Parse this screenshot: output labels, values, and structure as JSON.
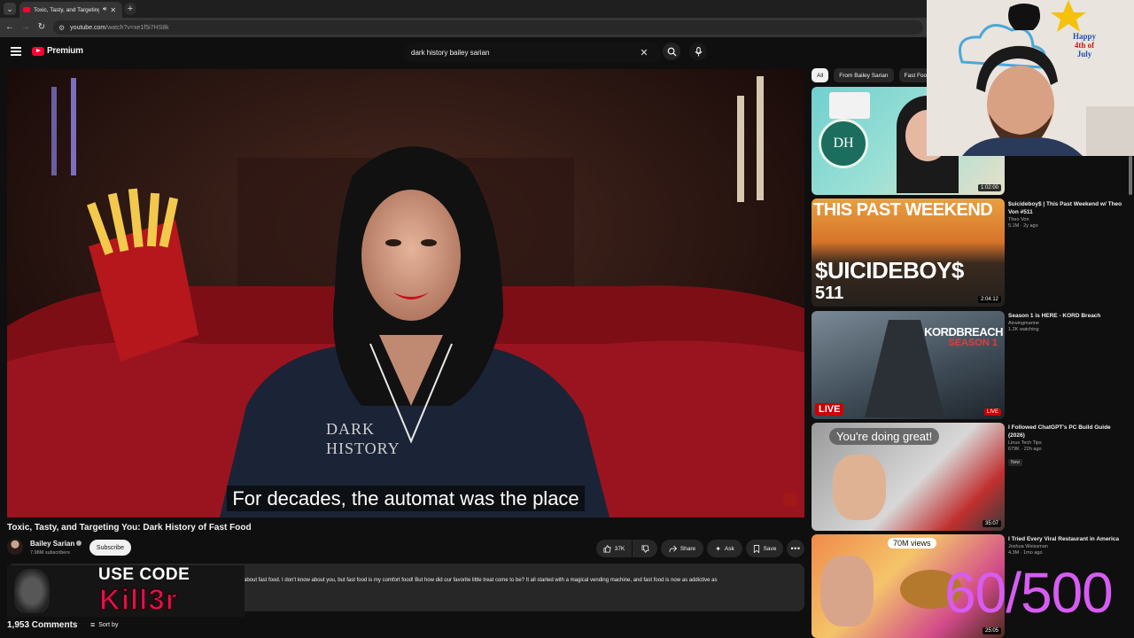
{
  "browser": {
    "tab_title": "Toxic, Tasty, and Targeting Y",
    "url_host": "youtube.com",
    "url_path": "/watch?v=xe1f5i7HS8k"
  },
  "masthead": {
    "brand": "Premium",
    "search_value": "dark history bailey sarian"
  },
  "player": {
    "caption": "For decades, the automat was the place",
    "shirt_text": "DARK HISTORY"
  },
  "video": {
    "title": "Toxic, Tasty, and Targeting You: Dark History of Fast Food",
    "channel": "Bailey Sarian",
    "subscribers": "7.98M subscribers",
    "subscribe_label": "Subscribe",
    "likes": "37K",
    "share_label": "Share",
    "ask_label": "Ask",
    "save_label": "Save",
    "description_stats": "2(",
    "description_text": "about fast food. I don't know about you, but fast food is my comfort food! But how did our favorite little treat come to be? It all started with a magical vending machine, and fast food is now as addictive as",
    "comments_count": "1,953 Comments",
    "sort_label": "Sort by"
  },
  "promo": {
    "line1": "USE CODE",
    "line2": "Kill3r"
  },
  "sidebar": {
    "chips": [
      "All",
      "From Bailey Sarian",
      "Fast Food"
    ],
    "recommendations": [
      {
        "title": "",
        "channel": "",
        "stats": "",
        "duration": "1:02:00",
        "thumb_text": "DH"
      },
      {
        "title": "$uicideboy$ | This Past Weekend w/ Theo Von #511",
        "channel": "Theo Von",
        "stats": "5.1M · 2y ago",
        "duration": "2:04:12",
        "thumb_text": "$UICIDEBOY$",
        "thumb_sub": "511",
        "thumb_top": "THIS PAST WEEKEND"
      },
      {
        "title": "Season 1 is HERE - KORD Breach",
        "channel": "Airwingmarine",
        "stats": "1.2K watching",
        "live_badge": "LIVE",
        "thumb_text": "KORDBREACH",
        "thumb_sub": "SEASON 1",
        "thumb_live": "LIVE"
      },
      {
        "title": "I Followed ChatGPT's PC Build Guide (2026)",
        "channel": "Linus Tech Tips",
        "stats": "679K · 22h ago",
        "badge": "New",
        "duration": "35:07",
        "thumb_text": "You're doing great!"
      },
      {
        "title": "I Tried Every Viral Restaurant in America",
        "channel": "Joshua Weissman",
        "stats": "4.3M · 1mo ago",
        "duration": "25:05",
        "thumb_text": "70M views"
      }
    ]
  },
  "webcam": {
    "sign_line1": "Happy",
    "sign_line2": "4th of",
    "sign_line3": "July"
  },
  "stream_goal": "60/500"
}
